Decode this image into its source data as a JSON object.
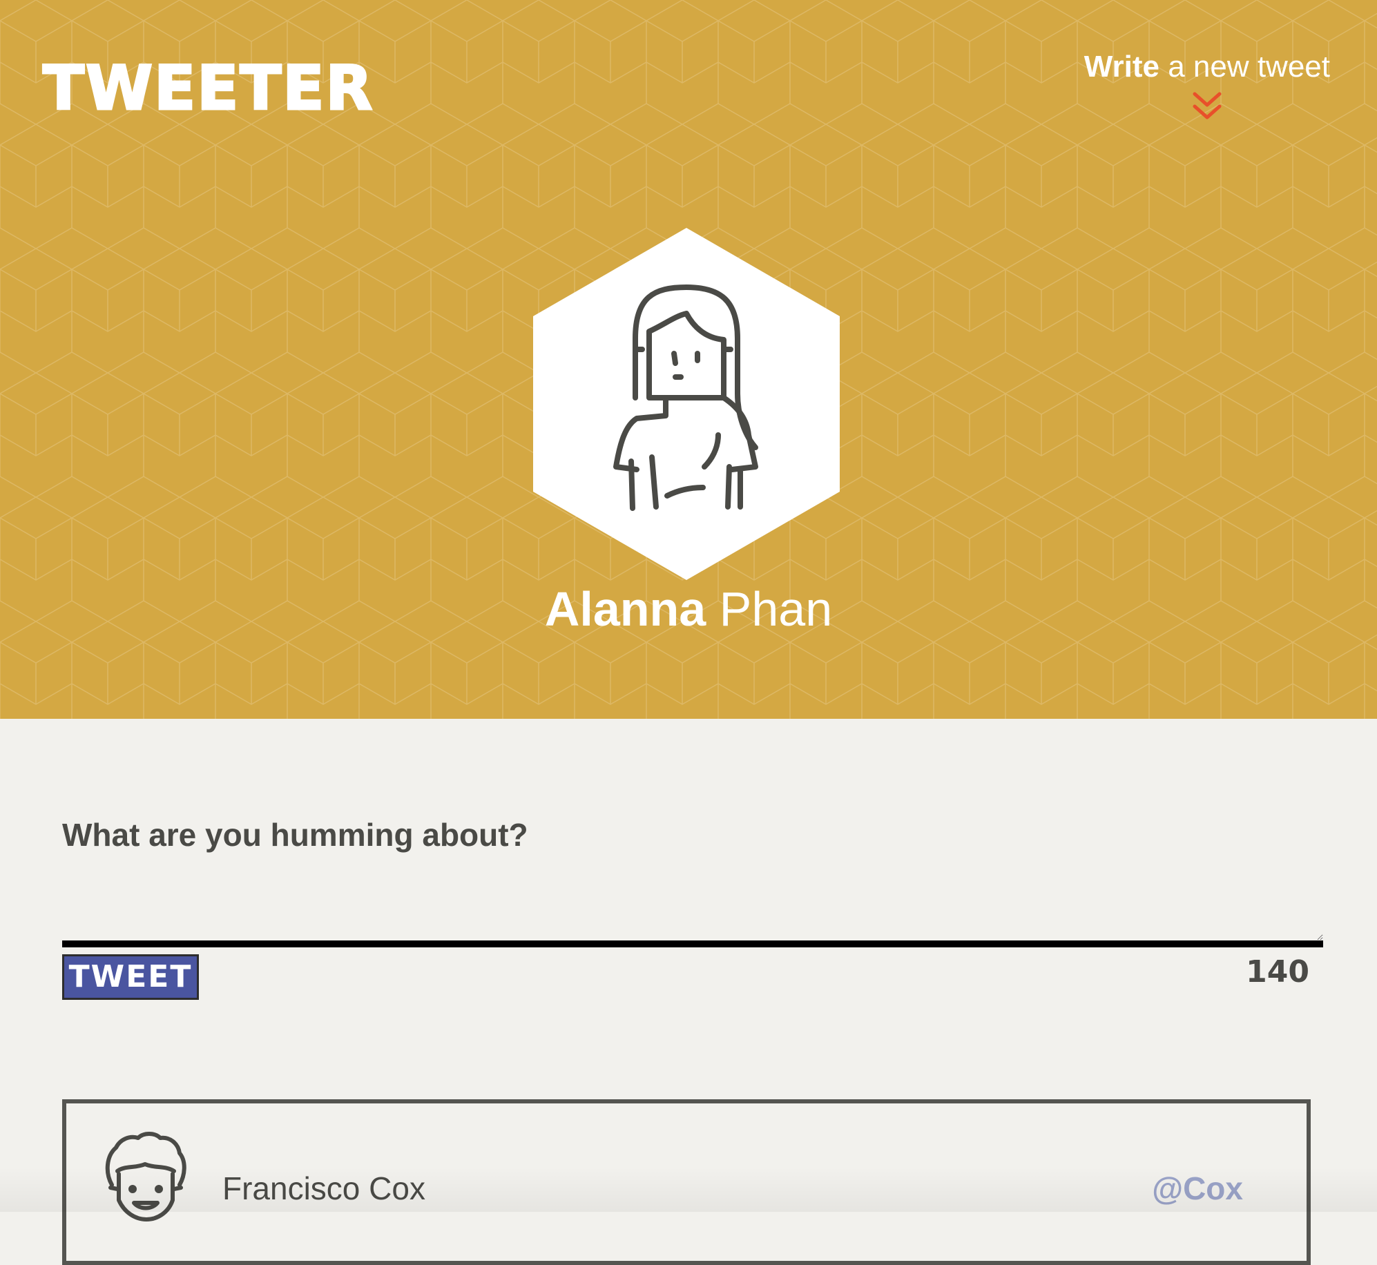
{
  "app": {
    "logo_text": "TWEETER"
  },
  "nav": {
    "compose_strong": "Write",
    "compose_rest": " a new tweet",
    "compose_icon": "double-chevron-down-icon"
  },
  "profile": {
    "first_name": "Alanna",
    "last_name": "Phan",
    "avatar_icon": "woman-avatar-icon"
  },
  "composer": {
    "prompt": "What are you humming about?",
    "input_value": "",
    "button_label": "TWEET",
    "char_count": "140"
  },
  "tweets": [
    {
      "name": "Francisco Cox",
      "handle": "@Cox",
      "avatar_icon": "curly-hair-man-avatar-icon"
    }
  ],
  "colors": {
    "banner": "#d4a843",
    "background": "#f2f1ed",
    "accent_chevron": "#e8502a",
    "button": "#4a55a0",
    "handle": "#9aa3c8",
    "text": "#4a4a46"
  }
}
